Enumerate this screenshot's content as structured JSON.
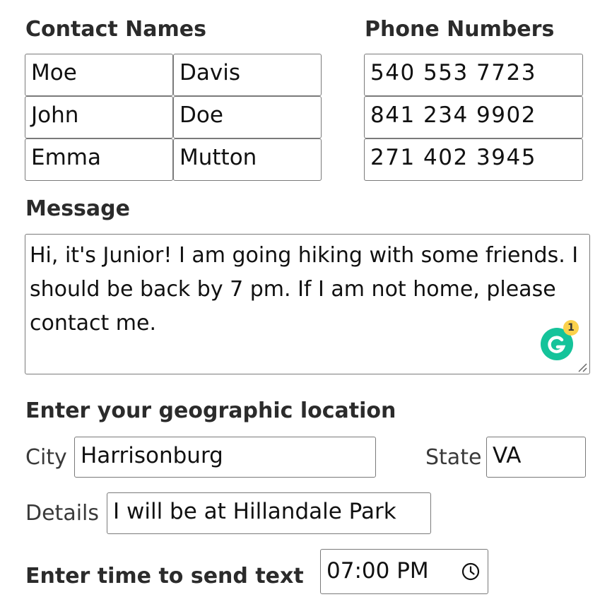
{
  "contacts": {
    "heading": "Contact Names",
    "rows": [
      {
        "first": "Moe",
        "last": "Davis"
      },
      {
        "first": "John",
        "last": "Doe"
      },
      {
        "first": "Emma",
        "last": "Mutton"
      }
    ]
  },
  "phones": {
    "heading": "Phone Numbers",
    "numbers": [
      "540 553 7723",
      "841 234 9902",
      "271 402 3945"
    ]
  },
  "message": {
    "heading": "Message",
    "text": "Hi, it's Junior! I am going hiking with some friends. I should be back by 7 pm. If I am not home, please contact me.",
    "grammarly_count": "1"
  },
  "location": {
    "heading": "Enter your geographic location",
    "city_label": "City",
    "city_value": "Harrisonburg",
    "state_label": "State",
    "state_value": "VA",
    "details_label": "Details",
    "details_value": "I will be at Hillandale Park"
  },
  "send_time": {
    "label": "Enter time to send text",
    "value": "07:00 PM"
  },
  "icons": {
    "grammarly": "grammarly-icon",
    "resize": "resize-handle-icon",
    "clock": "clock-icon"
  },
  "colors": {
    "grammarly_green": "#15c39a",
    "badge_yellow": "#fbd14b",
    "border": "#7a7a7a"
  }
}
